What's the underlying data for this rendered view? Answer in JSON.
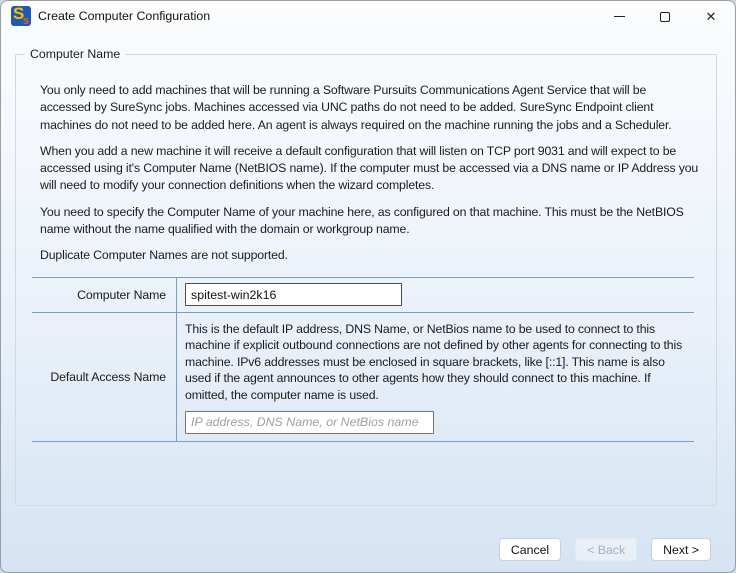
{
  "window": {
    "title": "Create Computer Configuration",
    "icon": {
      "main_letter": "S",
      "sub_letter": "s"
    },
    "controls": {
      "close_glyph": "✕"
    }
  },
  "group": {
    "title": "Computer Name",
    "paragraphs": [
      "You only need to add machines that will be running a Software Pursuits Communications Agent Service that will be accessed by SureSync jobs. Machines accessed via UNC paths do not need to be added. SureSync Endpoint client machines do not need to be added here. An agent is always required on the machine running the jobs and a Scheduler.",
      "When you add a new machine it will receive a default configuration that will listen on TCP port 9031 and will expect to be accessed using it's Computer Name (NetBIOS name). If the computer must be accessed via a DNS name or IP Address you will need to modify your connection definitions when the wizard completes.",
      "You need to specify the Computer Name of your machine here, as configured on that machine. This must be the NetBIOS name without the name qualified with the domain or workgroup name.",
      "Duplicate Computer Names are not supported."
    ]
  },
  "form": {
    "computer_name": {
      "label": "Computer Name",
      "value": "spitest-win2k16"
    },
    "default_access_name": {
      "label": "Default Access Name",
      "description": "This is the default IP address, DNS Name, or NetBios name to be used to connect to this machine if explicit outbound connections are not defined by other agents for connecting to this machine. IPv6 addresses must be enclosed in square brackets, like [::1]. This name is also used if the agent announces to other agents how they should connect to this machine. If omitted, the computer name is used.",
      "placeholder": "IP address, DNS Name, or NetBios name",
      "value": ""
    }
  },
  "buttons": [
    {
      "label": "Cancel",
      "enabled": true
    },
    {
      "label": "< Back",
      "enabled": false
    },
    {
      "label": "Next >",
      "enabled": true
    }
  ],
  "colors": {
    "titlebar_bg": "#fdfdfd",
    "dialog_top": "#f7fafd",
    "dialog_bottom": "#d5e3f3",
    "table_line": "#769fc8",
    "group_border": "#d4d9df",
    "text": "#1b1b1b",
    "placeholder_text": "#9aa0a6",
    "disabled_text": "#a6afba",
    "app_icon_blue": "#1f5bb5",
    "app_icon_yellow": "#f6c500",
    "app_icon_orange": "#e0680f"
  }
}
